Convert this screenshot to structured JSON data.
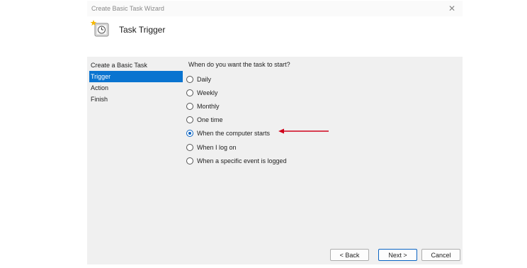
{
  "window": {
    "title": "Create Basic Task Wizard",
    "close_glyph": "✕"
  },
  "header": {
    "title": "Task Trigger",
    "icon": "clock-task-icon"
  },
  "nav": {
    "items": [
      {
        "label": "Create a Basic Task",
        "state": "header"
      },
      {
        "label": "Trigger",
        "state": "selected"
      },
      {
        "label": "Action",
        "state": "normal"
      },
      {
        "label": "Finish",
        "state": "normal"
      }
    ]
  },
  "main": {
    "question": "When do you want the task to start?",
    "options": [
      {
        "label": "Daily",
        "checked": false
      },
      {
        "label": "Weekly",
        "checked": false
      },
      {
        "label": "Monthly",
        "checked": false
      },
      {
        "label": "One time",
        "checked": false
      },
      {
        "label": "When the computer starts",
        "checked": true
      },
      {
        "label": "When I log on",
        "checked": false
      },
      {
        "label": "When a specific event is logged",
        "checked": false
      }
    ]
  },
  "buttons": {
    "back": "< Back",
    "next": "Next >",
    "cancel": "Cancel"
  },
  "colors": {
    "selection": "#0a74d0",
    "annotation_arrow": "#d0021b",
    "radio_checked": "#0a63c2"
  }
}
